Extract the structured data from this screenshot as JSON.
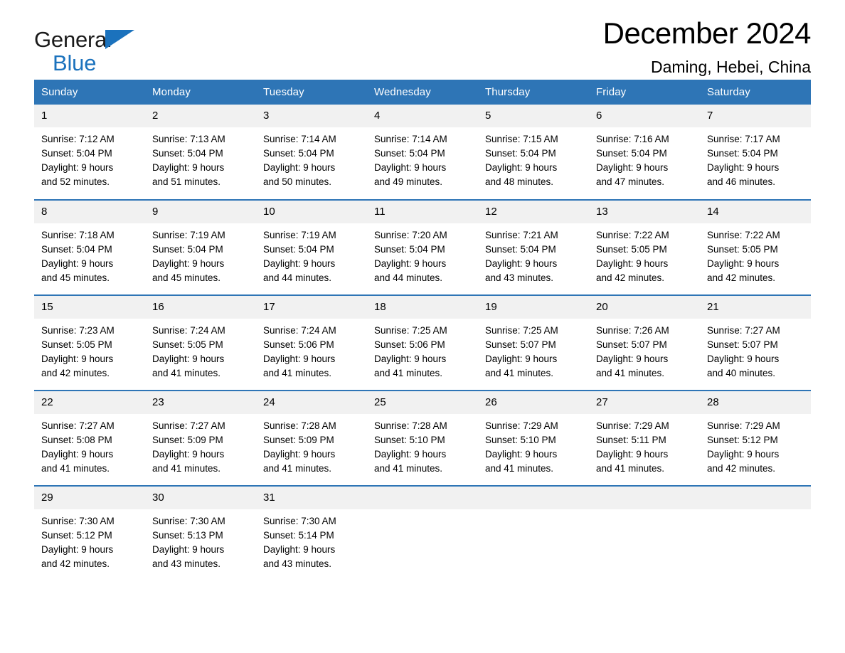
{
  "brand": {
    "name_part1": "General",
    "name_part2": "Blue",
    "flag_icon": "triangle-flag-icon",
    "accent_color": "#1b72bd"
  },
  "header": {
    "title": "December 2024",
    "location": "Daming, Hebei, China"
  },
  "theme": {
    "header_row_color": "#2e75b6",
    "daynum_band_color": "#f1f1f1",
    "divider_color": "#2e75b6",
    "text_color": "#000000"
  },
  "calendar": {
    "weekday_headers": [
      "Sunday",
      "Monday",
      "Tuesday",
      "Wednesday",
      "Thursday",
      "Friday",
      "Saturday"
    ],
    "labels": {
      "sunrise_prefix": "Sunrise:",
      "sunset_prefix": "Sunset:",
      "daylight_prefix": "Daylight:"
    },
    "weeks": [
      [
        {
          "day": "1",
          "line1": "Sunrise: 7:12 AM",
          "line2": "Sunset: 5:04 PM",
          "line3": "Daylight: 9 hours",
          "line4": "and 52 minutes."
        },
        {
          "day": "2",
          "line1": "Sunrise: 7:13 AM",
          "line2": "Sunset: 5:04 PM",
          "line3": "Daylight: 9 hours",
          "line4": "and 51 minutes."
        },
        {
          "day": "3",
          "line1": "Sunrise: 7:14 AM",
          "line2": "Sunset: 5:04 PM",
          "line3": "Daylight: 9 hours",
          "line4": "and 50 minutes."
        },
        {
          "day": "4",
          "line1": "Sunrise: 7:14 AM",
          "line2": "Sunset: 5:04 PM",
          "line3": "Daylight: 9 hours",
          "line4": "and 49 minutes."
        },
        {
          "day": "5",
          "line1": "Sunrise: 7:15 AM",
          "line2": "Sunset: 5:04 PM",
          "line3": "Daylight: 9 hours",
          "line4": "and 48 minutes."
        },
        {
          "day": "6",
          "line1": "Sunrise: 7:16 AM",
          "line2": "Sunset: 5:04 PM",
          "line3": "Daylight: 9 hours",
          "line4": "and 47 minutes."
        },
        {
          "day": "7",
          "line1": "Sunrise: 7:17 AM",
          "line2": "Sunset: 5:04 PM",
          "line3": "Daylight: 9 hours",
          "line4": "and 46 minutes."
        }
      ],
      [
        {
          "day": "8",
          "line1": "Sunrise: 7:18 AM",
          "line2": "Sunset: 5:04 PM",
          "line3": "Daylight: 9 hours",
          "line4": "and 45 minutes."
        },
        {
          "day": "9",
          "line1": "Sunrise: 7:19 AM",
          "line2": "Sunset: 5:04 PM",
          "line3": "Daylight: 9 hours",
          "line4": "and 45 minutes."
        },
        {
          "day": "10",
          "line1": "Sunrise: 7:19 AM",
          "line2": "Sunset: 5:04 PM",
          "line3": "Daylight: 9 hours",
          "line4": "and 44 minutes."
        },
        {
          "day": "11",
          "line1": "Sunrise: 7:20 AM",
          "line2": "Sunset: 5:04 PM",
          "line3": "Daylight: 9 hours",
          "line4": "and 44 minutes."
        },
        {
          "day": "12",
          "line1": "Sunrise: 7:21 AM",
          "line2": "Sunset: 5:04 PM",
          "line3": "Daylight: 9 hours",
          "line4": "and 43 minutes."
        },
        {
          "day": "13",
          "line1": "Sunrise: 7:22 AM",
          "line2": "Sunset: 5:05 PM",
          "line3": "Daylight: 9 hours",
          "line4": "and 42 minutes."
        },
        {
          "day": "14",
          "line1": "Sunrise: 7:22 AM",
          "line2": "Sunset: 5:05 PM",
          "line3": "Daylight: 9 hours",
          "line4": "and 42 minutes."
        }
      ],
      [
        {
          "day": "15",
          "line1": "Sunrise: 7:23 AM",
          "line2": "Sunset: 5:05 PM",
          "line3": "Daylight: 9 hours",
          "line4": "and 42 minutes."
        },
        {
          "day": "16",
          "line1": "Sunrise: 7:24 AM",
          "line2": "Sunset: 5:05 PM",
          "line3": "Daylight: 9 hours",
          "line4": "and 41 minutes."
        },
        {
          "day": "17",
          "line1": "Sunrise: 7:24 AM",
          "line2": "Sunset: 5:06 PM",
          "line3": "Daylight: 9 hours",
          "line4": "and 41 minutes."
        },
        {
          "day": "18",
          "line1": "Sunrise: 7:25 AM",
          "line2": "Sunset: 5:06 PM",
          "line3": "Daylight: 9 hours",
          "line4": "and 41 minutes."
        },
        {
          "day": "19",
          "line1": "Sunrise: 7:25 AM",
          "line2": "Sunset: 5:07 PM",
          "line3": "Daylight: 9 hours",
          "line4": "and 41 minutes."
        },
        {
          "day": "20",
          "line1": "Sunrise: 7:26 AM",
          "line2": "Sunset: 5:07 PM",
          "line3": "Daylight: 9 hours",
          "line4": "and 41 minutes."
        },
        {
          "day": "21",
          "line1": "Sunrise: 7:27 AM",
          "line2": "Sunset: 5:07 PM",
          "line3": "Daylight: 9 hours",
          "line4": "and 40 minutes."
        }
      ],
      [
        {
          "day": "22",
          "line1": "Sunrise: 7:27 AM",
          "line2": "Sunset: 5:08 PM",
          "line3": "Daylight: 9 hours",
          "line4": "and 41 minutes."
        },
        {
          "day": "23",
          "line1": "Sunrise: 7:27 AM",
          "line2": "Sunset: 5:09 PM",
          "line3": "Daylight: 9 hours",
          "line4": "and 41 minutes."
        },
        {
          "day": "24",
          "line1": "Sunrise: 7:28 AM",
          "line2": "Sunset: 5:09 PM",
          "line3": "Daylight: 9 hours",
          "line4": "and 41 minutes."
        },
        {
          "day": "25",
          "line1": "Sunrise: 7:28 AM",
          "line2": "Sunset: 5:10 PM",
          "line3": "Daylight: 9 hours",
          "line4": "and 41 minutes."
        },
        {
          "day": "26",
          "line1": "Sunrise: 7:29 AM",
          "line2": "Sunset: 5:10 PM",
          "line3": "Daylight: 9 hours",
          "line4": "and 41 minutes."
        },
        {
          "day": "27",
          "line1": "Sunrise: 7:29 AM",
          "line2": "Sunset: 5:11 PM",
          "line3": "Daylight: 9 hours",
          "line4": "and 41 minutes."
        },
        {
          "day": "28",
          "line1": "Sunrise: 7:29 AM",
          "line2": "Sunset: 5:12 PM",
          "line3": "Daylight: 9 hours",
          "line4": "and 42 minutes."
        }
      ],
      [
        {
          "day": "29",
          "line1": "Sunrise: 7:30 AM",
          "line2": "Sunset: 5:12 PM",
          "line3": "Daylight: 9 hours",
          "line4": "and 42 minutes."
        },
        {
          "day": "30",
          "line1": "Sunrise: 7:30 AM",
          "line2": "Sunset: 5:13 PM",
          "line3": "Daylight: 9 hours",
          "line4": "and 43 minutes."
        },
        {
          "day": "31",
          "line1": "Sunrise: 7:30 AM",
          "line2": "Sunset: 5:14 PM",
          "line3": "Daylight: 9 hours",
          "line4": "and 43 minutes."
        },
        {
          "day": "",
          "line1": "",
          "line2": "",
          "line3": "",
          "line4": ""
        },
        {
          "day": "",
          "line1": "",
          "line2": "",
          "line3": "",
          "line4": ""
        },
        {
          "day": "",
          "line1": "",
          "line2": "",
          "line3": "",
          "line4": ""
        },
        {
          "day": "",
          "line1": "",
          "line2": "",
          "line3": "",
          "line4": ""
        }
      ]
    ]
  }
}
